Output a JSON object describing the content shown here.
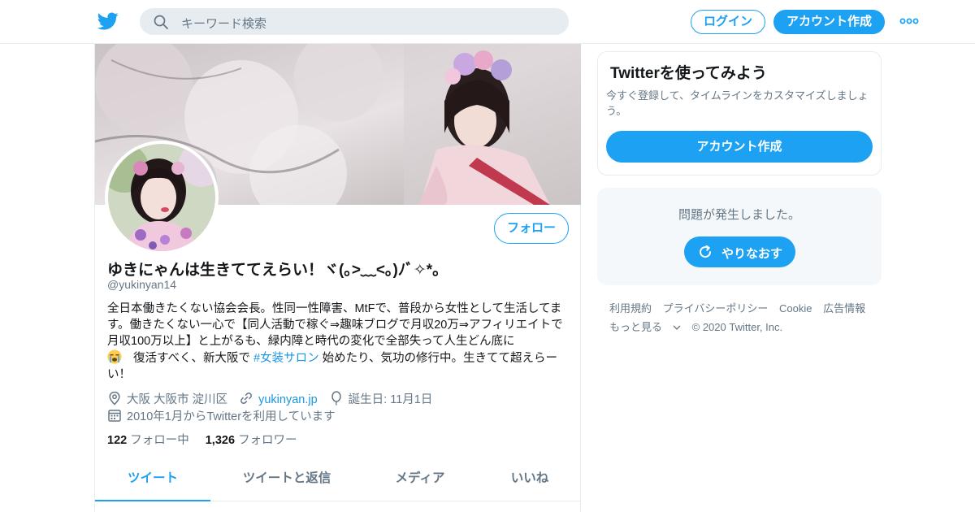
{
  "header": {
    "search_placeholder": "キーワード検索",
    "login_label": "ログイン",
    "signup_label": "アカウント作成"
  },
  "profile": {
    "follow_label": "フォロー",
    "display_name": "ゆきにゃんは生きててえらい！ヾ(｡>﹏<｡)ﾉﾞ✧*。",
    "handle": "@yukinyan14",
    "bio_part1": "全日本働きたくない協会会長。性同一性障害、MtFで、普段から女性として生活してます。働きたくない一心で【同人活動で稼ぐ⇒趣味ブログで月収20万⇒アフィリエイトで月収100万以上】と上がるも、緑内障と時代の変化で全部失って人生どん底に",
    "bio_part2": "復活すべく、新大阪で ",
    "bio_hashtag": "#女装サロン",
    "bio_part3": " 始めたり、気功の修行中。生きてて超えらーい！",
    "location": "大阪 大阪市 淀川区",
    "website": "yukinyan.jp",
    "birthday": "誕生日: 11月1日",
    "joined": "2010年1月からTwitterを利用しています",
    "following_count": "122",
    "following_label": "フォロー中",
    "followers_count": "1,326",
    "followers_label": "フォロワー"
  },
  "tabs": [
    {
      "label": "ツイート",
      "active": true
    },
    {
      "label": "ツイートと返信",
      "active": false
    },
    {
      "label": "メディア",
      "active": false
    },
    {
      "label": "いいね",
      "active": false
    }
  ],
  "signup_card": {
    "title": "Twitterを使ってみよう",
    "description": "今すぐ登録して、タイムラインをカスタマイズしましょう。",
    "button_label": "アカウント作成"
  },
  "error_card": {
    "message": "問題が発生しました。",
    "retry_label": "やりなおす"
  },
  "footer": {
    "links": [
      "利用規約",
      "プライバシーポリシー",
      "Cookie",
      "広告情報",
      "もっと見る"
    ],
    "copyright": "© 2020 Twitter, Inc."
  },
  "icons": {
    "logo": "twitter-bird-icon",
    "search": "search-icon",
    "more": "more-dots-icon",
    "location": "location-pin-icon",
    "link": "link-icon",
    "birthday": "balloon-icon",
    "calendar": "calendar-icon",
    "retry": "refresh-icon",
    "emoji": "crying-face-emoji"
  },
  "colors": {
    "brand": "#1da1f2",
    "link": "#1b95e0",
    "secondary_text": "#657786",
    "border": "#e6ecf0"
  }
}
